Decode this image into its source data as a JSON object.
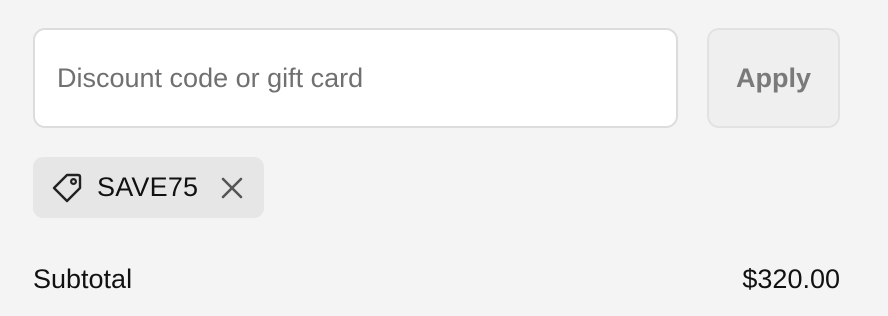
{
  "discount": {
    "input_placeholder": "Discount code or gift card",
    "input_value": "",
    "apply_label": "Apply"
  },
  "applied_code": {
    "icon": "tag-icon",
    "code": "SAVE75",
    "remove_icon": "close-icon"
  },
  "summary": {
    "subtotal_label": "Subtotal",
    "subtotal_value": "$320.00"
  },
  "colors": {
    "background": "#f4f4f4",
    "input_background": "#ffffff",
    "chip_background": "#e6e6e6",
    "button_background": "#efefef",
    "button_text": "#7a7a7a",
    "text": "#111111",
    "placeholder_text": "#707070"
  }
}
